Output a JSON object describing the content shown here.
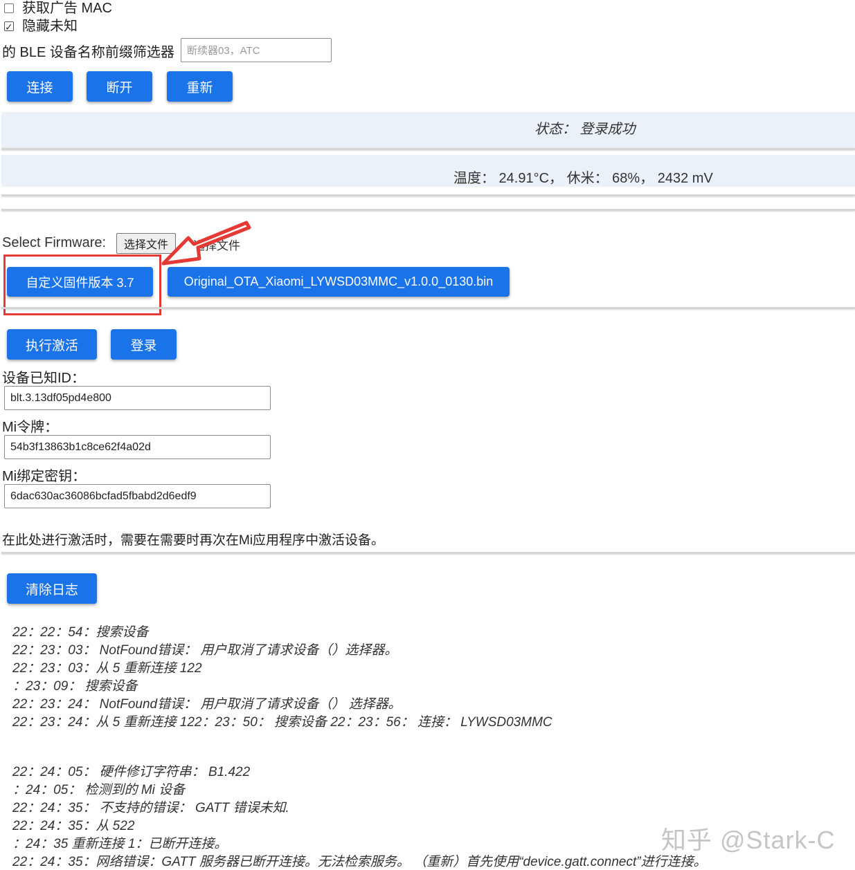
{
  "options": {
    "get_ad_mac": {
      "label": "获取广告 MAC",
      "checked": false
    },
    "hide_unknown": {
      "label": "隐藏未知",
      "checked": true
    }
  },
  "filter": {
    "label": "的 BLE 设备名称前缀筛选器",
    "placeholder": "断续器03，ATC"
  },
  "conn_buttons": {
    "connect": "连接",
    "disconnect": "断开",
    "reconnect": "重新"
  },
  "status": {
    "text": "状态：  登录成功"
  },
  "readings": {
    "text": "温度：  24.91°C，  休米：  68%，  2432 mV"
  },
  "firmware": {
    "label": "Select Firmware:",
    "file_button": "选择文件",
    "file_status": "未选择文件",
    "custom_button": "自定义固件版本 3.7",
    "original_button": "Original_OTA_Xiaomi_LYWSD03MMC_v1.0.0_0130.bin"
  },
  "actions": {
    "activate": "执行激活",
    "login": "登录"
  },
  "device": {
    "id_label": "设备已知ID：",
    "id_value": "blt.3.13df05pd4e800",
    "token_label": "Mi令牌：",
    "token_value": "54b3f13863b1c8ce62f4a02d",
    "bind_key_label": "Mi绑定密钥：",
    "bind_key_value": "6dac630ac36086bcfad5fbabd2d6edf9"
  },
  "note": "在此处进行激活时，需要在需要时再次在Mi应用程序中激活设备。",
  "clear_log": "清除日志",
  "log": [
    "22：22：54：搜索设备",
    "22：23：03：  NotFound错误：  用户取消了请求设备（）选择器。",
    "22：23：03：从 5 重新连接 122",
    "：23：09：  搜索设备",
    "22：23：24：  NotFound错误：  用户取消了请求设备（）  选择器。",
    "22：23：24：从 5 重新连接 122：23：50：  搜索设备 22：23：56：  连接：  LYWSD03MMC",
    "22：24：05：  硬件修订字符串：  B1.422",
    "：24：05：  检测到的 Mi 设备",
    "22：24：35：  不支持的错误：  GATT 错误未知.",
    "22：24：35：从 522",
    "：24：35 重新连接 1：已断开连接。",
    "22：24：35：网络错误：GATT 服务器已断开连接。无法检索服务。  （重新）首先使用“device.gatt.connect”进行连接。"
  ],
  "watermark": "知乎 @Stark-C",
  "colors": {
    "button": "#1a73e8",
    "band": "#eaf1f8",
    "highlight": "#e53935"
  }
}
